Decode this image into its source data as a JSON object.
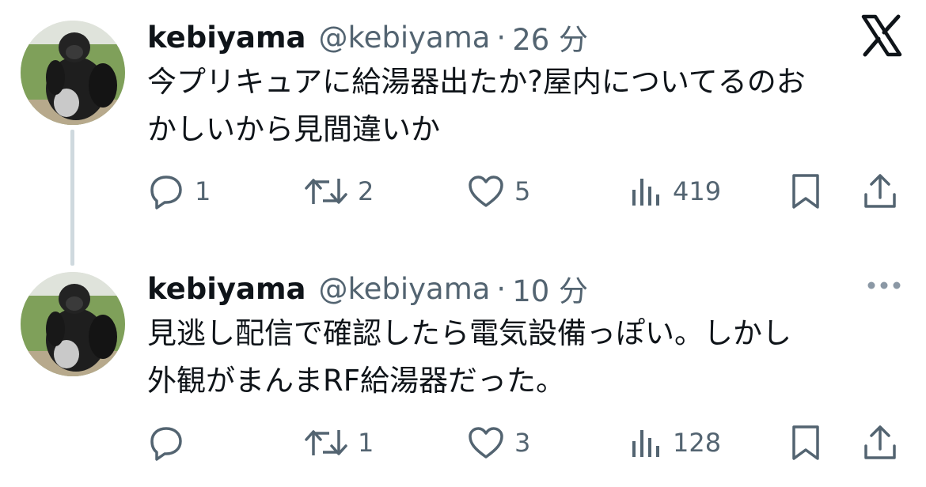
{
  "tweets": [
    {
      "user": {
        "name": "kebiyama",
        "handle": "@kebiyama",
        "avatar_icon": "gorilla-avatar"
      },
      "separator": "·",
      "time": "26 分",
      "text_lines": [
        "今プリキュアに給湯器出たか?屋内についてるのお",
        "かしいから見間違いか"
      ],
      "corner_icon": "x-logo-icon",
      "actions": {
        "reply_count": "1",
        "retweet_count": "2",
        "like_count": "5",
        "views_count": "419"
      }
    },
    {
      "user": {
        "name": "kebiyama",
        "handle": "@kebiyama",
        "avatar_icon": "gorilla-avatar"
      },
      "separator": "·",
      "time": "10 分",
      "text_lines": [
        "見逃し配信で確認したら電気設備っぽい。しかし",
        "外観がまんまRF給湯器だった。"
      ],
      "corner_icon": "more-options-icon",
      "actions": {
        "reply_count": "",
        "retweet_count": "1",
        "like_count": "3",
        "views_count": "128"
      }
    }
  ],
  "colors": {
    "text_primary": "#0f1419",
    "text_secondary": "#536471",
    "thread_line": "#cfd9de",
    "background": "#ffffff"
  }
}
